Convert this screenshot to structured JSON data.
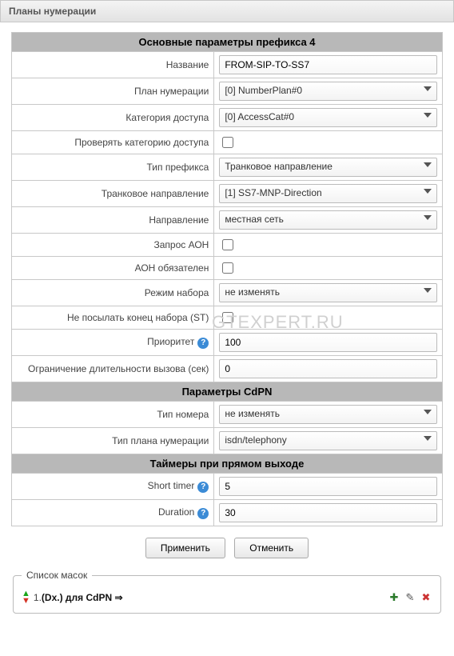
{
  "page_title": "Планы нумерации",
  "watermark": "GTEXPERT.RU",
  "sections": {
    "main": "Основные параметры префикса 4",
    "cdpn": "Параметры CdPN",
    "timers": "Таймеры при прямом выходе"
  },
  "labels": {
    "name": "Название",
    "numbering_plan": "План нумерации",
    "access_category": "Категория доступа",
    "check_access": "Проверять категорию доступа",
    "prefix_type": "Тип префикса",
    "trunk_direction": "Транковое направление",
    "direction": "Направление",
    "aon_request": "Запрос АОН",
    "aon_required": "АОН обязателен",
    "dial_mode": "Режим набора",
    "no_st": "Не посылать конец набора (ST)",
    "priority": "Приоритет",
    "call_limit": "Ограничение длительности вызова (сек)",
    "number_type": "Тип номера",
    "plan_type": "Тип плана нумерации",
    "short_timer": "Short timer",
    "duration": "Duration"
  },
  "values": {
    "name": "FROM-SIP-TO-SS7",
    "numbering_plan": "[0] NumberPlan#0",
    "access_category": "[0] AccessCat#0",
    "check_access": false,
    "prefix_type": "Транковое направление",
    "trunk_direction": "[1] SS7-MNP-Direction",
    "direction": "местная сеть",
    "aon_request": false,
    "aon_required": false,
    "dial_mode": "не изменять",
    "no_st": false,
    "priority": "100",
    "call_limit": "0",
    "number_type": "не изменять",
    "plan_type": "isdn/telephony",
    "short_timer": "5",
    "duration": "30"
  },
  "buttons": {
    "apply": "Применить",
    "cancel": "Отменить"
  },
  "masks": {
    "legend": "Список масок",
    "item_index": "1.",
    "item_pattern": "(Dx.)",
    "item_for": " для CdPN ⇒"
  },
  "help_glyph": "?"
}
